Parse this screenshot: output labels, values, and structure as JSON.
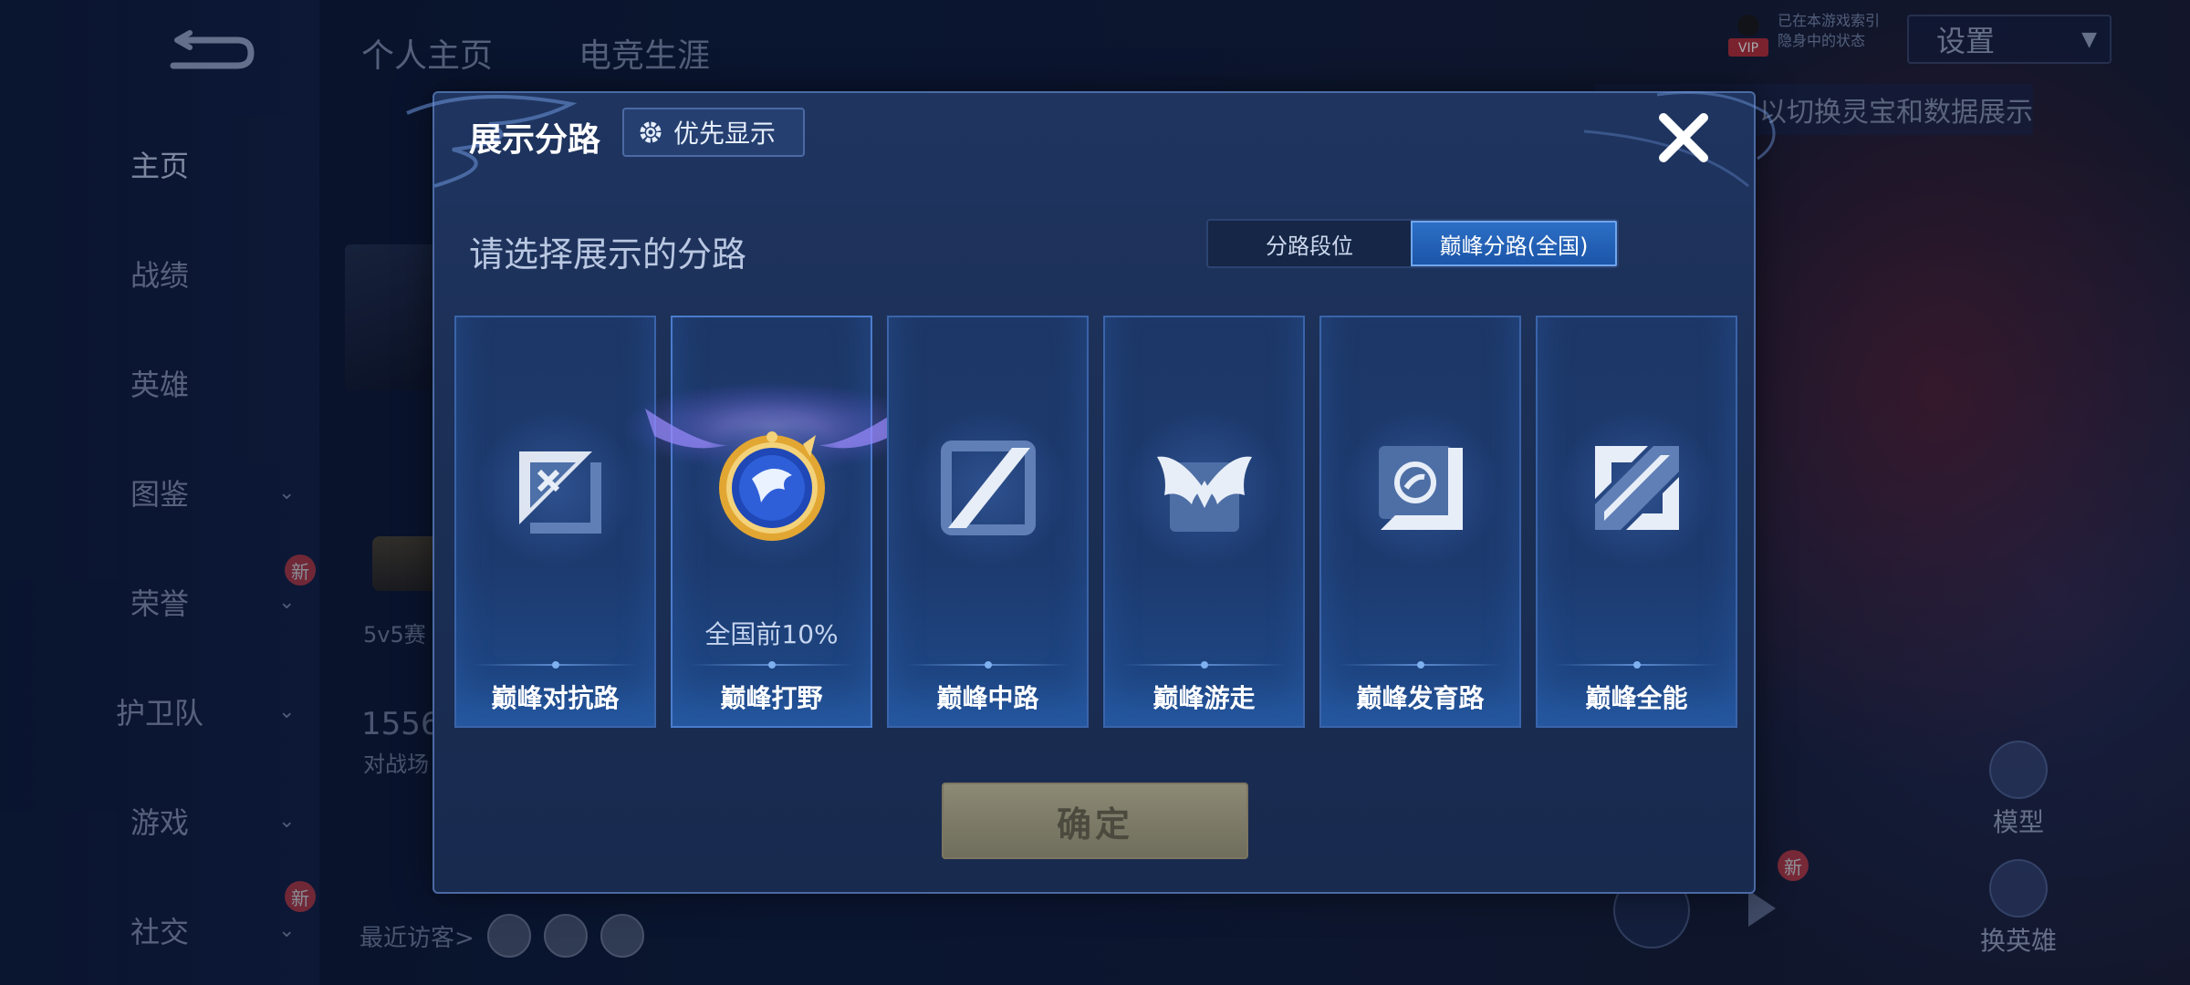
{
  "background": {
    "tabs": [
      "个人主页",
      "电竞生涯"
    ],
    "sidebar": [
      {
        "label": "主页",
        "active": true,
        "chevron": false,
        "new": false
      },
      {
        "label": "战绩",
        "active": false,
        "chevron": false,
        "new": false
      },
      {
        "label": "英雄",
        "active": false,
        "chevron": false,
        "new": false
      },
      {
        "label": "图鉴",
        "active": false,
        "chevron": true,
        "new": false
      },
      {
        "label": "荣誉",
        "active": false,
        "chevron": true,
        "new": true
      },
      {
        "label": "护卫队",
        "active": false,
        "chevron": true,
        "new": false
      },
      {
        "label": "游戏",
        "active": false,
        "chevron": true,
        "new": false
      },
      {
        "label": "社交",
        "active": false,
        "chevron": true,
        "new": true
      }
    ],
    "new_badge": "新",
    "settings_label": "设置",
    "hint_text": "以切换灵宝和数据展示",
    "vip_label": "VIP",
    "vip_line1": "已在本游戏索引",
    "vip_line2": "隐身中的状态",
    "mode_text": "5v5赛",
    "stat_number": "1556",
    "stat_label": "对战场",
    "visitors_label": "最近访客>",
    "model_label": "模型",
    "switch_hero_label": "换英雄"
  },
  "modal": {
    "title": "展示分路",
    "priority_button": "优先显示",
    "subtitle": "请选择展示的分路",
    "segments": [
      {
        "label": "分路段位",
        "active": false
      },
      {
        "label": "巅峰分路(全国)",
        "active": true
      }
    ],
    "cards": [
      {
        "label": "巅峰对抗路",
        "rank": "",
        "icon": "clash-lane-icon"
      },
      {
        "label": "巅峰打野",
        "rank": "全国前10%",
        "icon": "jungle-dragon-emblem-icon",
        "selected": true
      },
      {
        "label": "巅峰中路",
        "rank": "",
        "icon": "mid-lane-icon"
      },
      {
        "label": "巅峰游走",
        "rank": "",
        "icon": "roam-wings-icon"
      },
      {
        "label": "巅峰发育路",
        "rank": "",
        "icon": "farm-lane-icon"
      },
      {
        "label": "巅峰全能",
        "rank": "",
        "icon": "all-round-icon"
      }
    ],
    "confirm_label": "确定"
  }
}
